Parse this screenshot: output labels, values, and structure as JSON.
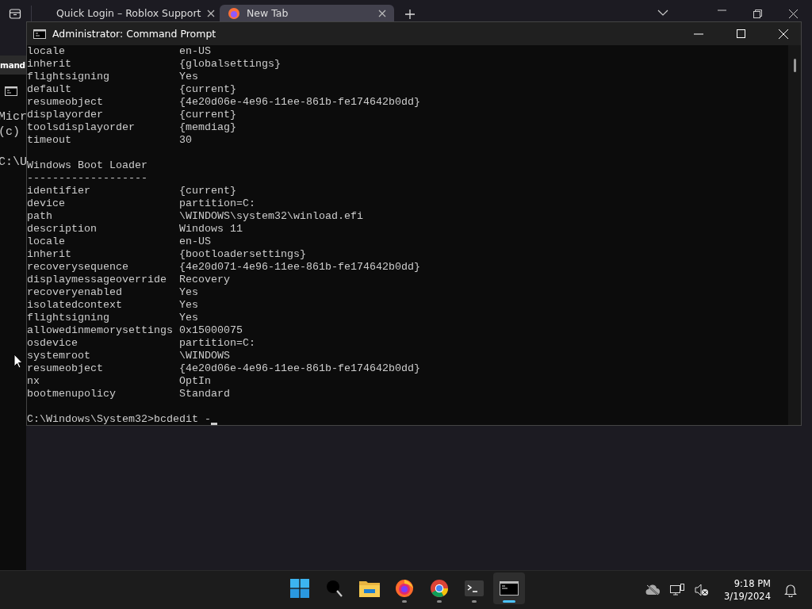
{
  "browser": {
    "tabs": [
      {
        "title": "Quick Login – Roblox Support",
        "selected": false
      },
      {
        "title": "New Tab",
        "selected": true
      }
    ]
  },
  "background_window": {
    "title": "mand",
    "lines": [
      "Micr",
      "(c)",
      "C:\\U"
    ]
  },
  "console": {
    "title": "Administrator: Command Prompt",
    "lines": [
      {
        "kind": "pair",
        "key": "locale",
        "value": "en-US"
      },
      {
        "kind": "pair",
        "key": "inherit",
        "value": "{globalsettings}"
      },
      {
        "kind": "pair",
        "key": "flightsigning",
        "value": "Yes"
      },
      {
        "kind": "pair",
        "key": "default",
        "value": "{current}"
      },
      {
        "kind": "pair",
        "key": "resumeobject",
        "value": "{4e20d06e-4e96-11ee-861b-fe174642b0dd}"
      },
      {
        "kind": "pair",
        "key": "displayorder",
        "value": "{current}"
      },
      {
        "kind": "pair",
        "key": "toolsdisplayorder",
        "value": "{memdiag}"
      },
      {
        "kind": "pair",
        "key": "timeout",
        "value": "30"
      },
      {
        "kind": "blank"
      },
      {
        "kind": "text",
        "text": "Windows Boot Loader"
      },
      {
        "kind": "text",
        "text": "-------------------"
      },
      {
        "kind": "pair",
        "key": "identifier",
        "value": "{current}"
      },
      {
        "kind": "pair",
        "key": "device",
        "value": "partition=C:"
      },
      {
        "kind": "pair",
        "key": "path",
        "value": "\\WINDOWS\\system32\\winload.efi"
      },
      {
        "kind": "pair",
        "key": "description",
        "value": "Windows 11"
      },
      {
        "kind": "pair",
        "key": "locale",
        "value": "en-US"
      },
      {
        "kind": "pair",
        "key": "inherit",
        "value": "{bootloadersettings}"
      },
      {
        "kind": "pair",
        "key": "recoverysequence",
        "value": "{4e20d071-4e96-11ee-861b-fe174642b0dd}"
      },
      {
        "kind": "pair",
        "key": "displaymessageoverride",
        "value": "Recovery"
      },
      {
        "kind": "pair",
        "key": "recoveryenabled",
        "value": "Yes"
      },
      {
        "kind": "pair",
        "key": "isolatedcontext",
        "value": "Yes"
      },
      {
        "kind": "pair",
        "key": "flightsigning",
        "value": "Yes"
      },
      {
        "kind": "pair",
        "key": "allowedinmemorysettings",
        "value": "0x15000075"
      },
      {
        "kind": "pair",
        "key": "osdevice",
        "value": "partition=C:"
      },
      {
        "kind": "pair",
        "key": "systemroot",
        "value": "\\WINDOWS"
      },
      {
        "kind": "pair",
        "key": "resumeobject",
        "value": "{4e20d06e-4e96-11ee-861b-fe174642b0dd}"
      },
      {
        "kind": "pair",
        "key": "nx",
        "value": "OptIn"
      },
      {
        "kind": "pair",
        "key": "bootmenupolicy",
        "value": "Standard"
      },
      {
        "kind": "blank"
      },
      {
        "kind": "prompt",
        "text": "C:\\Windows\\System32>bcdedit -"
      }
    ]
  },
  "taskbar": {
    "apps": [
      {
        "kind": "start",
        "running": false,
        "selected": false
      },
      {
        "kind": "search",
        "running": false,
        "selected": false
      },
      {
        "kind": "folder",
        "running": false,
        "selected": false
      },
      {
        "kind": "firefox",
        "running": true,
        "selected": false
      },
      {
        "kind": "chrome",
        "running": true,
        "selected": false
      },
      {
        "kind": "terminal",
        "running": true,
        "selected": false
      },
      {
        "kind": "cmd",
        "running": true,
        "selected": true
      }
    ],
    "clock": {
      "time": "9:18 PM",
      "date": "3/19/2024"
    }
  }
}
